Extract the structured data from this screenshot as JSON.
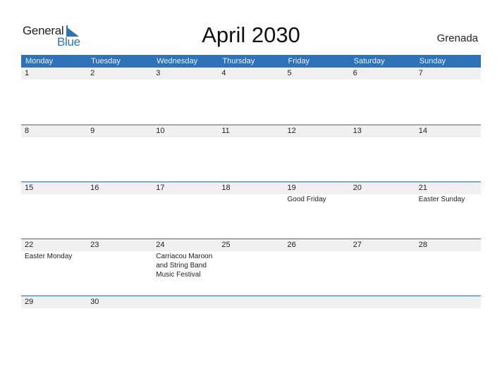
{
  "logo": {
    "line1": "General",
    "line2": "Blue"
  },
  "title": "April 2030",
  "country": "Grenada",
  "colors": {
    "accent": "#2e73b8",
    "date_strip": "#f0f0f0"
  },
  "weekdays": [
    "Monday",
    "Tuesday",
    "Wednesday",
    "Thursday",
    "Friday",
    "Saturday",
    "Sunday"
  ],
  "weeks": [
    {
      "days": [
        "1",
        "2",
        "3",
        "4",
        "5",
        "6",
        "7"
      ],
      "events": [
        "",
        "",
        "",
        "",
        "",
        "",
        ""
      ]
    },
    {
      "days": [
        "8",
        "9",
        "10",
        "11",
        "12",
        "13",
        "14"
      ],
      "events": [
        "",
        "",
        "",
        "",
        "",
        "",
        ""
      ]
    },
    {
      "days": [
        "15",
        "16",
        "17",
        "18",
        "19",
        "20",
        "21"
      ],
      "events": [
        "",
        "",
        "",
        "",
        "Good Friday",
        "",
        "Easter Sunday"
      ]
    },
    {
      "days": [
        "22",
        "23",
        "24",
        "25",
        "26",
        "27",
        "28"
      ],
      "events": [
        "Easter Monday",
        "",
        "Carriacou Maroon and String Band Music Festival",
        "",
        "",
        "",
        ""
      ]
    },
    {
      "days": [
        "29",
        "30",
        "",
        "",
        "",
        "",
        ""
      ],
      "events": [
        "",
        "",
        "",
        "",
        "",
        "",
        ""
      ]
    }
  ]
}
